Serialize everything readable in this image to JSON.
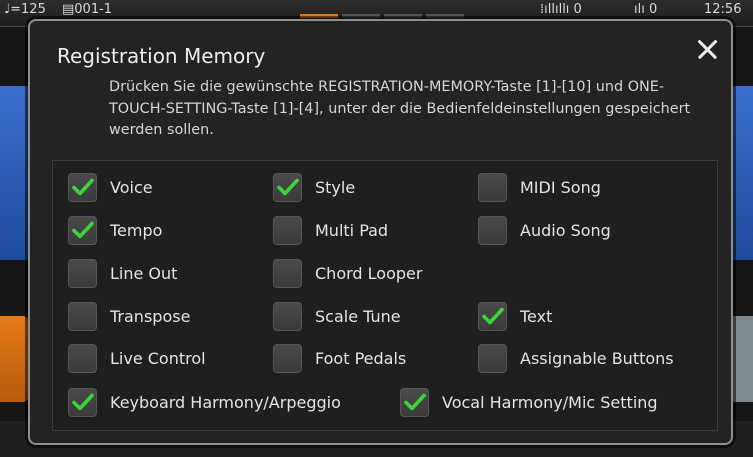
{
  "statusbar": {
    "tempo": "♩=125",
    "registration": "▤001-1",
    "level_left": "⁞ıllıllı 0",
    "level_right": "ılı 0",
    "clock": "12:56"
  },
  "colors": {
    "dialog_bg": "#232323",
    "dialog_border": "#8f8f8f",
    "check_green": "#3bd63b",
    "accent_orange": "#e07a1c"
  },
  "dialog": {
    "title": "Registration Memory",
    "close_icon": "close-icon",
    "description": "Drücken Sie die gewünschte REGISTRATION-MEMORY-Taste [1]-[10] und ONE-TOUCH-SETTING-Taste [1]-[4], unter der die Bedienfeldeinstellungen gespeichert werden sollen.",
    "items": [
      {
        "label": "Voice",
        "checked": true
      },
      {
        "label": "Style",
        "checked": true
      },
      {
        "label": "MIDI Song",
        "checked": false
      },
      {
        "label": "Tempo",
        "checked": true
      },
      {
        "label": "Multi Pad",
        "checked": false
      },
      {
        "label": "Audio Song",
        "checked": false
      },
      {
        "label": "Line Out",
        "checked": false
      },
      {
        "label": "Chord Looper",
        "checked": false
      },
      {
        "label": "Transpose",
        "checked": false
      },
      {
        "label": "Scale Tune",
        "checked": false
      },
      {
        "label": "Text",
        "checked": true
      },
      {
        "label": "Live Control",
        "checked": false
      },
      {
        "label": "Foot Pedals",
        "checked": false
      },
      {
        "label": "Assignable Buttons",
        "checked": false
      },
      {
        "label": "Keyboard Harmony/Arpeggio",
        "checked": true
      },
      {
        "label": "Vocal Harmony/Mic Setting",
        "checked": true
      }
    ]
  }
}
